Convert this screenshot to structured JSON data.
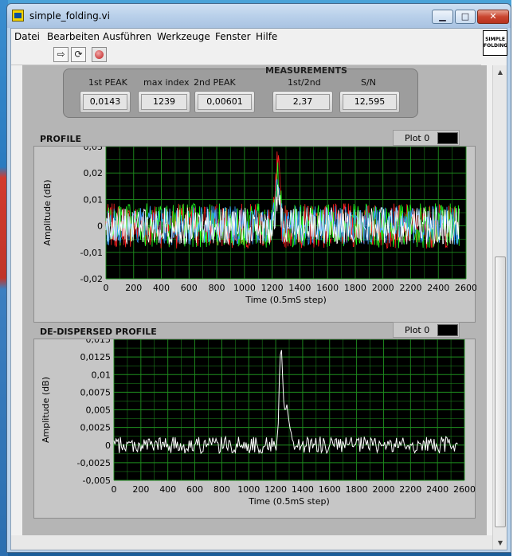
{
  "window": {
    "title": "simple_folding.vi",
    "vi_icon_text": "SIMPLE FOLDING"
  },
  "menu": [
    "Datei",
    "Bearbeiten",
    "Ausführen",
    "Werkzeuge",
    "Fenster",
    "Hilfe"
  ],
  "toolbar": {
    "run_icon": "run-arrow-icon",
    "continuous_run_icon": "continuous-run-icon",
    "abort_icon": "abort-stop-icon"
  },
  "measurements": {
    "title": "MEASUREMENTS",
    "first_peak": {
      "label": "1st PEAK",
      "value": "0,0143"
    },
    "max_index": {
      "label": "max index",
      "value": "1239"
    },
    "second_peak": {
      "label": "2nd PEAK",
      "value": "0,00601"
    },
    "ratio": {
      "label": "1st/2nd",
      "value": "2,37"
    },
    "sn": {
      "label": "S/N",
      "value": "12,595"
    }
  },
  "profile": {
    "label": "PROFILE",
    "legend": "Plot 0"
  },
  "dedispersed": {
    "label": "DE-DISPERSED PROFILE",
    "legend": "Plot 0"
  },
  "chart_data": [
    {
      "type": "line",
      "title": "PROFILE",
      "xlabel": "Time (0.5mS step)",
      "ylabel": "Amplitude (dB)",
      "xlim": [
        0,
        2600
      ],
      "ylim": [
        -0.02,
        0.03
      ],
      "xticks": [
        "0",
        "200",
        "400",
        "600",
        "800",
        "1000",
        "1200",
        "1400",
        "1600",
        "1800",
        "2000",
        "2200",
        "2400",
        "2600"
      ],
      "yticks": [
        "0,03",
        "0,02",
        "0,01",
        "0",
        "-0,01",
        "-0,02"
      ],
      "grid": true,
      "background": "#000000",
      "grid_color": "#1f8f1f",
      "series": [
        {
          "color": "#ff2020",
          "noise": 0.0085,
          "peak": 0.022,
          "peak_x": 1240
        },
        {
          "color": "#20ff20",
          "noise": 0.0085,
          "peak": 0.018,
          "peak_x": 1245
        },
        {
          "color": "#3aa0ff",
          "noise": 0.0075,
          "peak": 0.016,
          "peak_x": 1238
        },
        {
          "color": "#ffffff",
          "noise": 0.007,
          "peak": 0.012,
          "peak_x": 1242
        }
      ],
      "x_range": [
        0,
        2550
      ]
    },
    {
      "type": "line",
      "title": "DE-DISPERSED PROFILE",
      "xlabel": "Time (0.5mS step)",
      "ylabel": "Amplitude (dB)",
      "xlim": [
        0,
        2600
      ],
      "ylim": [
        -0.005,
        0.015
      ],
      "xticks": [
        "0",
        "200",
        "400",
        "600",
        "800",
        "1000",
        "1200",
        "1400",
        "1600",
        "1800",
        "2000",
        "2200",
        "2400",
        "2600"
      ],
      "yticks": [
        "0,015",
        "0,0125",
        "0,01",
        "0,0075",
        "0,005",
        "0,0025",
        "0",
        "-0,0025",
        "-0,005"
      ],
      "grid": true,
      "background": "#000000",
      "grid_color": "#1f8f1f",
      "series": [
        {
          "color": "#ffffff",
          "noise": 0.0012,
          "peak": 0.0143,
          "peak_x": 1239,
          "secondary_peak": 0.006,
          "secondary_x": 1280
        }
      ],
      "x_range": [
        0,
        2550
      ]
    }
  ]
}
